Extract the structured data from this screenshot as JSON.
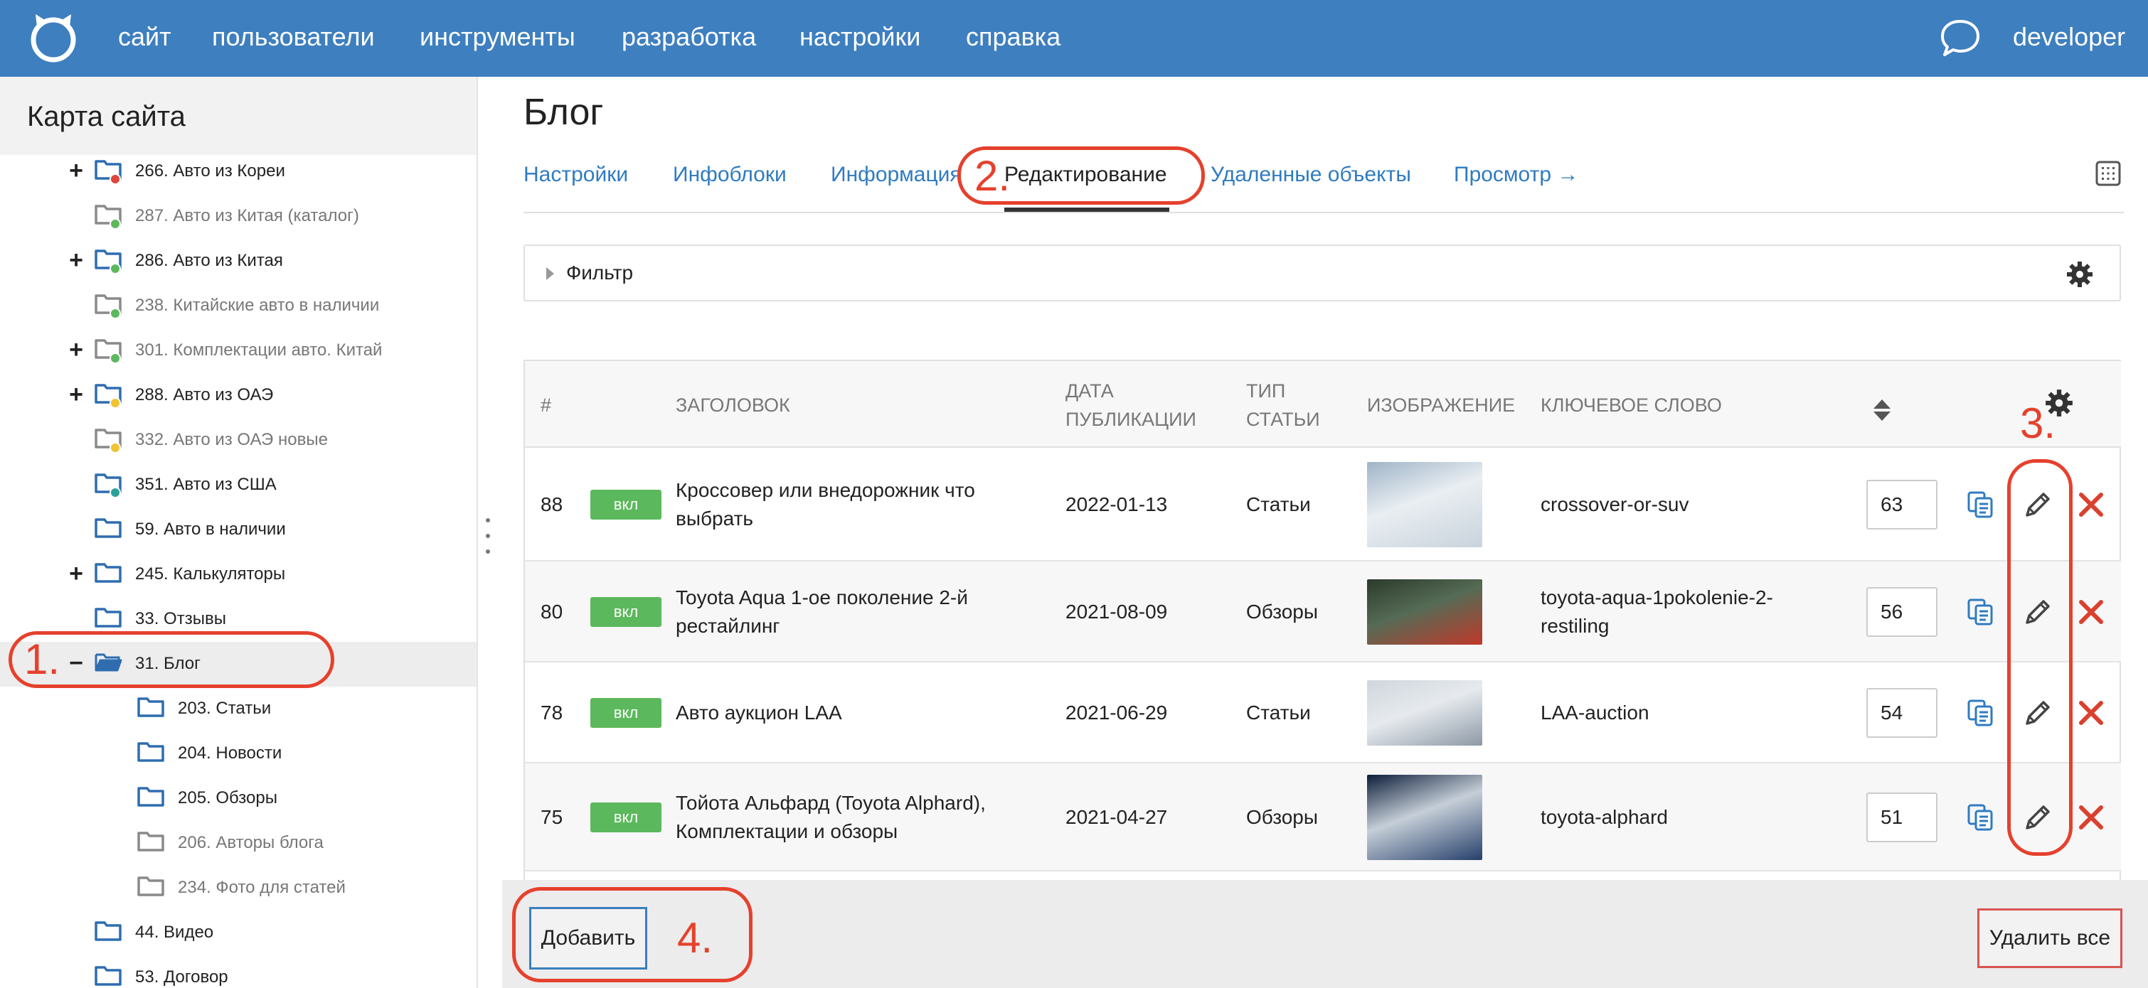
{
  "topbar": {
    "nav": [
      "сайт",
      "пользователи",
      "инструменты",
      "разработка",
      "настройки",
      "справка"
    ],
    "user": "developer",
    "bg_color": "#3e7fbf"
  },
  "sidebar": {
    "title": "Карта сайта",
    "items": [
      {
        "label": "266. Авто из Кореи",
        "toggle": "+",
        "dot": "#e0443a",
        "grey": false,
        "icon": "folder-blue-icon"
      },
      {
        "label": "287. Авто из Китая (каталог)",
        "toggle": "",
        "dot": "#5cb85c",
        "grey": true,
        "icon": "folder-grey-icon"
      },
      {
        "label": "286. Авто из Китая",
        "toggle": "+",
        "dot": "#5cb85c",
        "grey": false,
        "icon": "folder-blue-icon"
      },
      {
        "label": "238. Китайские авто в наличии",
        "toggle": "",
        "dot": "#5cb85c",
        "grey": true,
        "icon": "folder-grey-icon"
      },
      {
        "label": "301. Комплектации авто. Китай",
        "toggle": "+",
        "dot": "#5cb85c",
        "grey": true,
        "icon": "folder-grey-icon"
      },
      {
        "label": "288. Авто из ОАЭ",
        "toggle": "+",
        "dot": "#f0c330",
        "grey": false,
        "icon": "folder-blue-icon"
      },
      {
        "label": "332. Авто из ОАЭ новые",
        "toggle": "",
        "dot": "#f0c330",
        "grey": true,
        "icon": "folder-grey-icon"
      },
      {
        "label": "351. Авто из США",
        "toggle": "",
        "dot": "#2aa198",
        "grey": false,
        "icon": "folder-blue-icon"
      },
      {
        "label": "59. Авто в наличии",
        "toggle": "",
        "dot": "",
        "grey": false,
        "icon": "folder-blue-icon"
      },
      {
        "label": "245. Калькуляторы",
        "toggle": "+",
        "dot": "",
        "grey": false,
        "icon": "folder-blue-icon"
      },
      {
        "label": "33. Отзывы",
        "toggle": "",
        "dot": "",
        "grey": false,
        "icon": "folder-blue-icon"
      },
      {
        "label": "31. Блог",
        "toggle": "−",
        "dot": "",
        "grey": false,
        "icon": "folder-open-icon",
        "active": true
      },
      {
        "label": "203. Статьи",
        "toggle": "",
        "dot": "",
        "grey": false,
        "icon": "folder-blue-icon",
        "child": true
      },
      {
        "label": "204. Новости",
        "toggle": "",
        "dot": "",
        "grey": false,
        "icon": "folder-blue-icon",
        "child": true
      },
      {
        "label": "205. Обзоры",
        "toggle": "",
        "dot": "",
        "grey": false,
        "icon": "folder-blue-icon",
        "child": true
      },
      {
        "label": "206. Авторы блога",
        "toggle": "",
        "dot": "",
        "grey": true,
        "icon": "folder-grey-icon",
        "child": true
      },
      {
        "label": "234. Фото для статей",
        "toggle": "",
        "dot": "",
        "grey": true,
        "icon": "folder-grey-icon",
        "child": true
      },
      {
        "label": "44. Видео",
        "toggle": "",
        "dot": "",
        "grey": false,
        "icon": "folder-blue-icon"
      },
      {
        "label": "53. Договор",
        "toggle": "",
        "dot": "",
        "grey": false,
        "icon": "folder-blue-icon"
      }
    ]
  },
  "main": {
    "title": "Блог",
    "tabs": [
      "Настройки",
      "Инфоблоки",
      "Информация",
      "Редактирование",
      "Удаленные объекты",
      "Просмотр →"
    ],
    "active_tab": "Редактирование",
    "filter_label": "Фильтр",
    "table": {
      "headers": {
        "num": "#",
        "title": "ЗАГОЛОВОК",
        "date_l1": "ДАТА",
        "date_l2": "ПУБЛИКАЦИИ",
        "type_l1": "ТИП",
        "type_l2": "СТАТЬИ",
        "image": "ИЗОБРАЖЕНИЕ",
        "keyword": "КЛЮЧЕВОЕ СЛОВО"
      },
      "rows": [
        {
          "id": "88",
          "status": "вкл",
          "title_l1": "Кроссовер или внедорожник что",
          "title_l2": "выбрать",
          "date": "2022-01-13",
          "type": "Статьи",
          "keyword_l1": "crossover-or-suv",
          "keyword_l2": "",
          "priority": "63"
        },
        {
          "id": "80",
          "status": "вкл",
          "title_l1": "Toyota Aqua 1-ое поколение 2-й",
          "title_l2": "рестайлинг",
          "date": "2021-08-09",
          "type": "Обзоры",
          "keyword_l1": "toyota-aqua-1pokolenie-2-",
          "keyword_l2": "restiling",
          "priority": "56"
        },
        {
          "id": "78",
          "status": "вкл",
          "title_l1": "Авто аукцион LAA",
          "title_l2": "",
          "date": "2021-06-29",
          "type": "Статьи",
          "keyword_l1": "LAA-auction",
          "keyword_l2": "",
          "priority": "54"
        },
        {
          "id": "75",
          "status": "вкл",
          "title_l1": "Тойота Альфард (Toyota Alphard),",
          "title_l2": "Комплектации и обзоры",
          "date": "2021-04-27",
          "type": "Обзоры",
          "keyword_l1": "toyota-alphard",
          "keyword_l2": "",
          "priority": "51"
        }
      ]
    }
  },
  "footer": {
    "add_label": "Добавить",
    "delete_all_label": "Удалить все"
  },
  "annotations": [
    "1.",
    "2.",
    "3.",
    "4."
  ]
}
